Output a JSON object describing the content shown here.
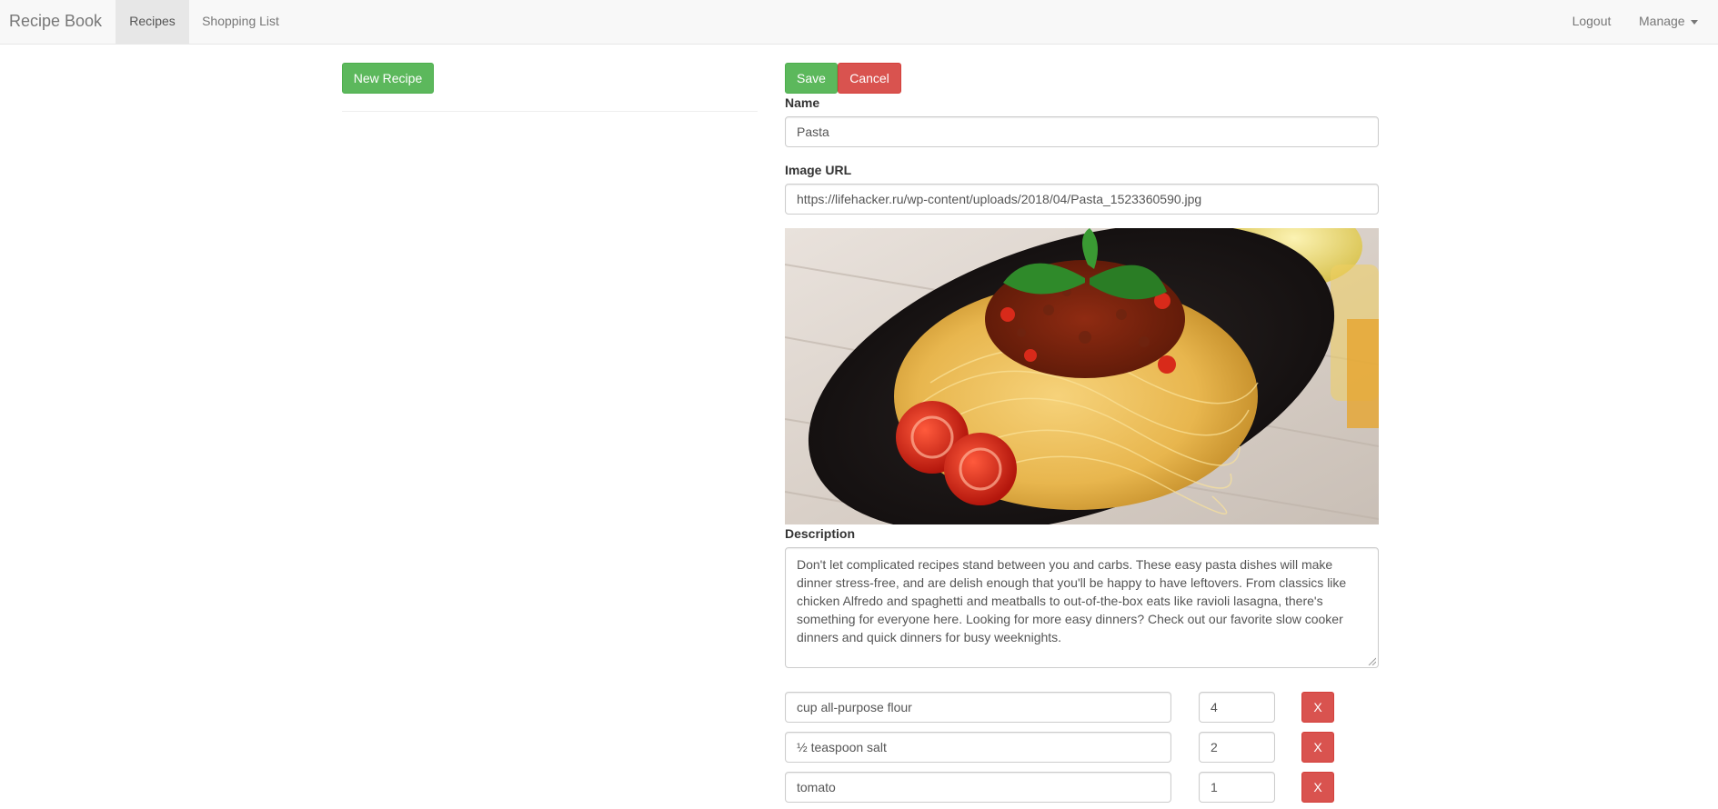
{
  "navbar": {
    "brand": "Recipe Book",
    "links": [
      {
        "label": "Recipes",
        "active": true
      },
      {
        "label": "Shopping List",
        "active": false
      }
    ],
    "logout": "Logout",
    "manage": "Manage"
  },
  "left": {
    "new_recipe_label": "New Recipe"
  },
  "form": {
    "save_label": "Save",
    "cancel_label": "Cancel",
    "name_label": "Name",
    "name_value": "Pasta",
    "image_url_label": "Image URL",
    "image_url_value": "https://lifehacker.ru/wp-content/uploads/2018/04/Pasta_1523360590.jpg",
    "description_label": "Description",
    "description_value": "Don't let complicated recipes stand between you and carbs. These easy pasta dishes will make dinner stress-free, and are delish enough that you'll be happy to have leftovers. From classics like chicken Alfredo and spaghetti and meatballs to out-of-the-box eats like ravioli lasagna, there's something for everyone here. Looking for more easy dinners? Check out our favorite slow cooker dinners and quick dinners for busy weeknights.",
    "ingredients": [
      {
        "name": "cup all-purpose flour",
        "amount": "4",
        "remove_label": "X"
      },
      {
        "name": "½ teaspoon salt",
        "amount": "2",
        "remove_label": "X"
      },
      {
        "name": "tomato",
        "amount": "1",
        "remove_label": "X"
      }
    ]
  },
  "colors": {
    "success": "#5cb85c",
    "danger": "#d9534f",
    "navbar_bg": "#f8f8f8"
  }
}
